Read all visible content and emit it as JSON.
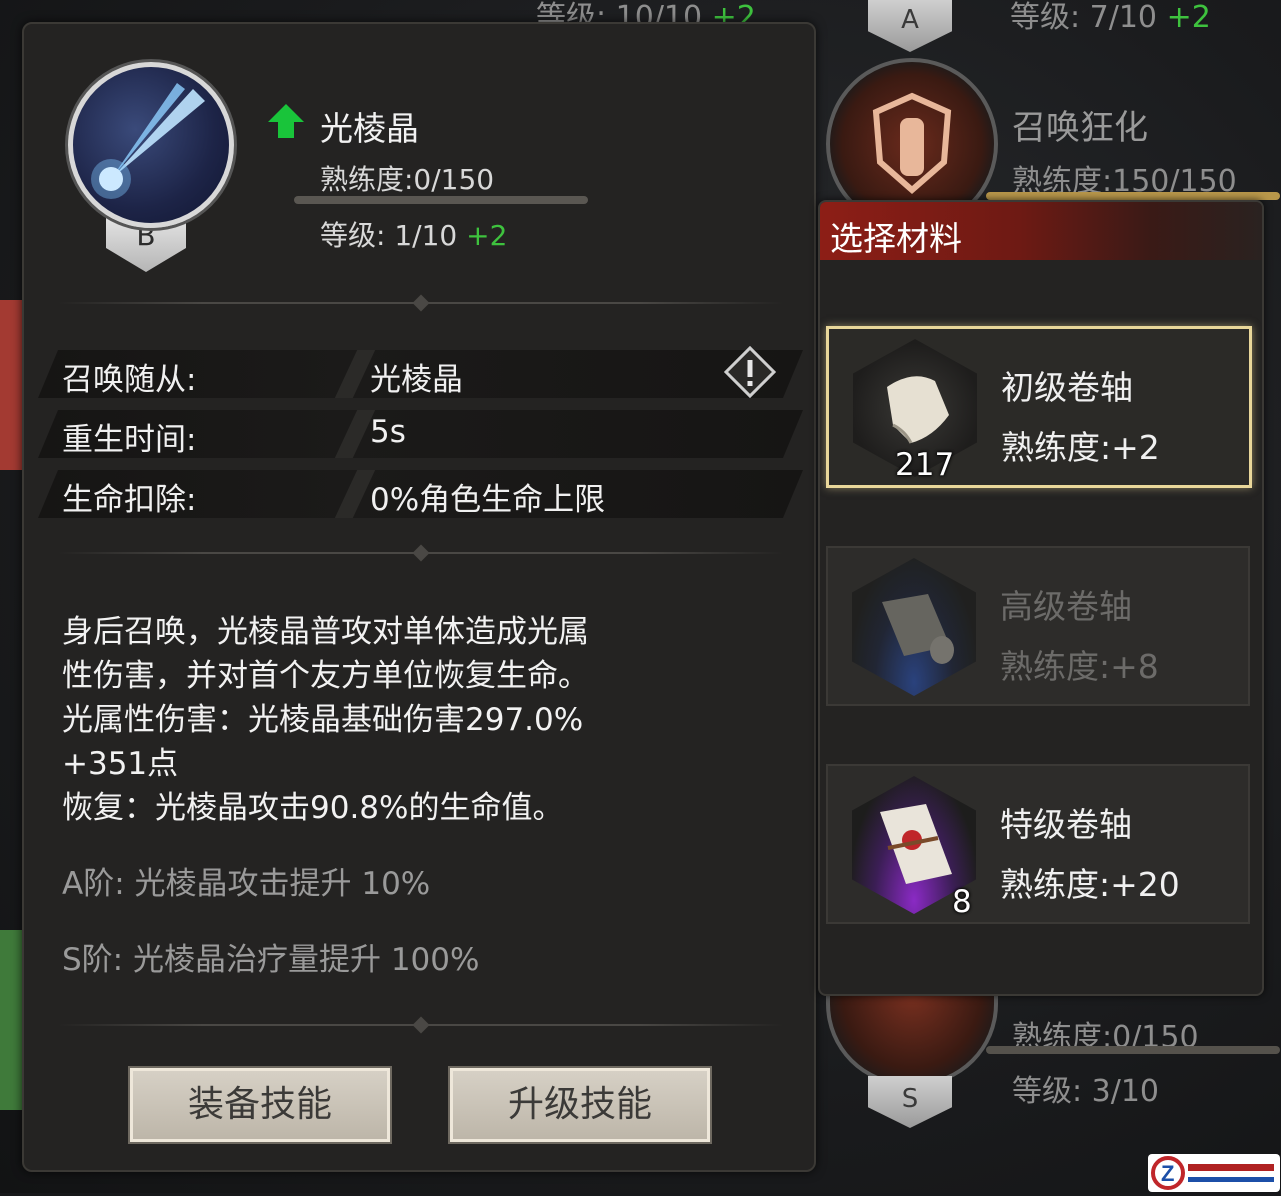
{
  "skill": {
    "grade": "B",
    "name": "光棱晶",
    "proficiency": "熟练度:0/150",
    "proficiency_progress": 0,
    "level_prefix": "等级: 1/10",
    "level_bonus": "+2"
  },
  "stats": [
    {
      "label": "召唤随从:",
      "value": "光棱晶"
    },
    {
      "label": "重生时间:",
      "value": "5s"
    },
    {
      "label": "生命扣除:",
      "value": "0%角色生命上限"
    }
  ],
  "description": {
    "lines": [
      "身后召唤，光棱晶普攻对单体造成光属",
      "性伤害，并对首个友方单位恢复生命。",
      "光属性伤害：光棱晶基础伤害297.0%",
      "+351点",
      "恢复：光棱晶攻击90.8%的生命值。"
    ],
    "tier_a": "A阶: 光棱晶攻击提升 10%",
    "tier_s": "S阶: 光棱晶治疗量提升 100%"
  },
  "buttons": {
    "equip": "装备技能",
    "upgrade": "升级技能"
  },
  "materials": {
    "title": "选择材料",
    "items": [
      {
        "name": "初级卷轴",
        "exp": "熟练度:+2",
        "count": "217",
        "selected": true
      },
      {
        "name": "高级卷轴",
        "exp": "熟练度:+8",
        "count": "",
        "selected": false
      },
      {
        "name": "特级卷轴",
        "exp": "熟练度:+20",
        "count": "8",
        "selected": false
      }
    ]
  },
  "background": {
    "top_left_level": "等级: 10/10",
    "top_left_bonus": "+2",
    "top_right_level": "等级: 7/10",
    "top_right_bonus": "+2",
    "top_right_grade": "A",
    "summon_name": "召唤狂化",
    "summon_proficiency": "熟练度:150/150",
    "bottom_proficiency": "熟练度:0/150",
    "bottom_level": "等级: 3/10",
    "bottom_grade": "S"
  },
  "colors": {
    "accent_green": "#3ec23e",
    "header_red": "#8d1e16",
    "selected_border": "#e9d79a"
  }
}
